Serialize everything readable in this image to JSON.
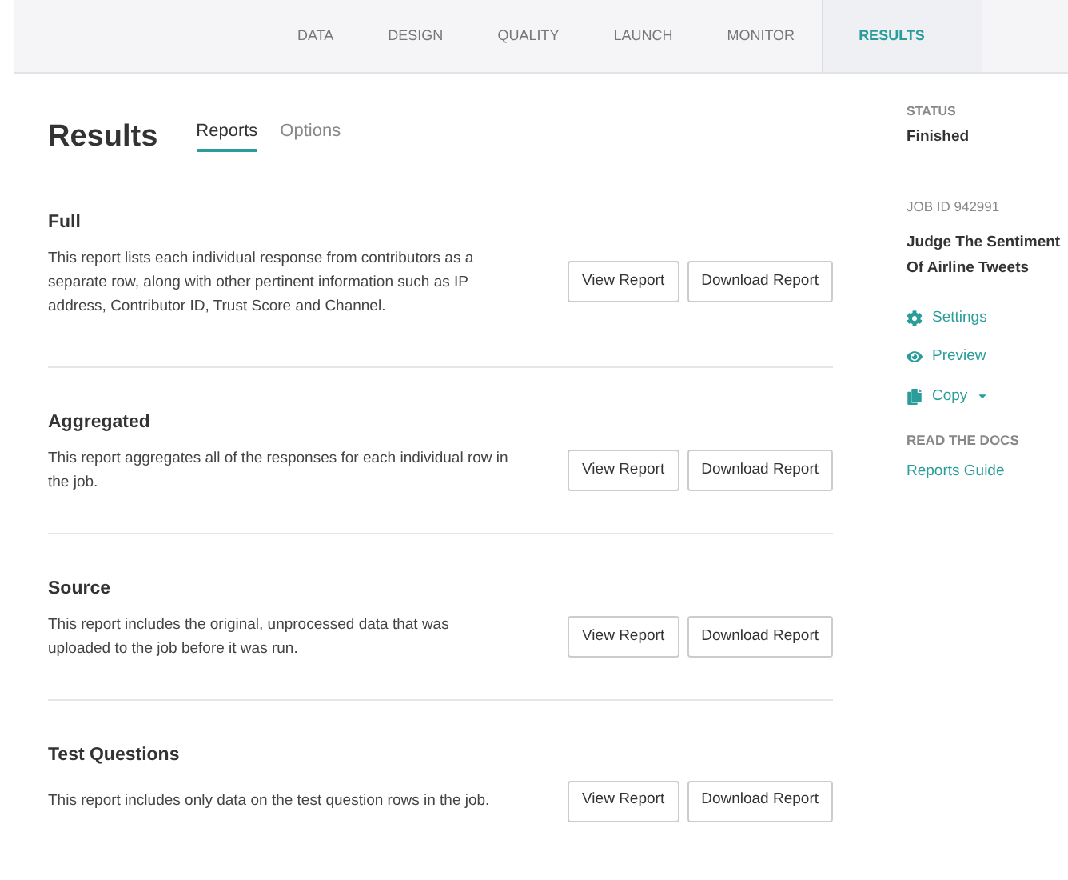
{
  "nav": [
    {
      "label": "DATA",
      "selected": false
    },
    {
      "label": "DESIGN",
      "selected": false
    },
    {
      "label": "QUALITY",
      "selected": false
    },
    {
      "label": "LAUNCH",
      "selected": false
    },
    {
      "label": "MONITOR",
      "selected": false
    },
    {
      "label": "RESULTS",
      "selected": true
    }
  ],
  "page_title": "Results",
  "tabs": [
    {
      "label": "Reports",
      "selected": true
    },
    {
      "label": "Options",
      "selected": false
    }
  ],
  "reports": [
    {
      "title": "Full",
      "description": "This report lists each individual response from contributors as a separate row, along with other pertinent information such as IP address, Contributor ID, Trust Score and Channel.",
      "buttons": [
        "View Report",
        "Download Report"
      ]
    },
    {
      "title": "Aggregated",
      "description": "This report aggregates all of the responses for each individual row in the job.",
      "buttons": [
        "View Report",
        "Download Report"
      ]
    },
    {
      "title": "Source",
      "description": "This report includes the original, unprocessed data that was uploaded to the job before it was run.",
      "buttons": [
        "View Report",
        "Download Report"
      ]
    },
    {
      "title": "Test Questions",
      "description": "This report includes only data on the test question rows in the job.",
      "buttons": [
        "View Report",
        "Download Report"
      ]
    }
  ],
  "sidebar": {
    "status_label": "STATUS",
    "status": "Finished",
    "job_id": "JOB ID 942991",
    "job_name": "Judge The Sentiment Of Airline Tweets",
    "actions": [
      {
        "kind": "settings",
        "label": "Settings",
        "has_menu": false
      },
      {
        "kind": "preview",
        "label": "Preview",
        "has_menu": false
      },
      {
        "kind": "copy",
        "label": "Copy",
        "has_menu": true
      }
    ],
    "docs_label": "READ THE DOCS",
    "docs_link": "Reports Guide"
  }
}
